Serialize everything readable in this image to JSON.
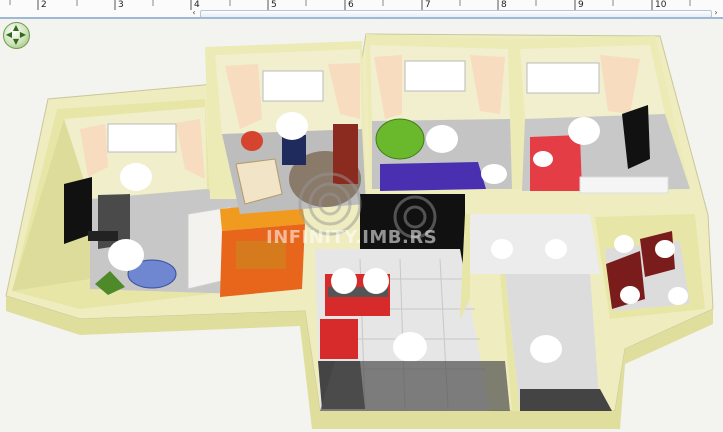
{
  "ruler": {
    "labels": [
      "2",
      "3",
      "4",
      "5",
      "6",
      "7",
      "8",
      "9",
      "10"
    ],
    "scroll_left_label": "‹",
    "scroll_right_label": "›"
  },
  "navigator": {
    "icon": "navigation-arrows-icon",
    "up": "▲",
    "down": "▼",
    "left": "◀",
    "right": "▶"
  },
  "watermark": {
    "text": "INFINITY.IMB.RS"
  },
  "colors": {
    "wall": "#f3f1c6",
    "wall_side": "#e9e7a8",
    "floor_tile": "#cfcfcf",
    "floor_grey": "#8f8f8f",
    "sofa_orange": "#e8651c",
    "bed_purple": "#4b2fb1",
    "bed_red": "#e43d46",
    "black_counter": "#111111",
    "red_cabinet": "#d72a2a",
    "dark_counter": "#444444"
  }
}
